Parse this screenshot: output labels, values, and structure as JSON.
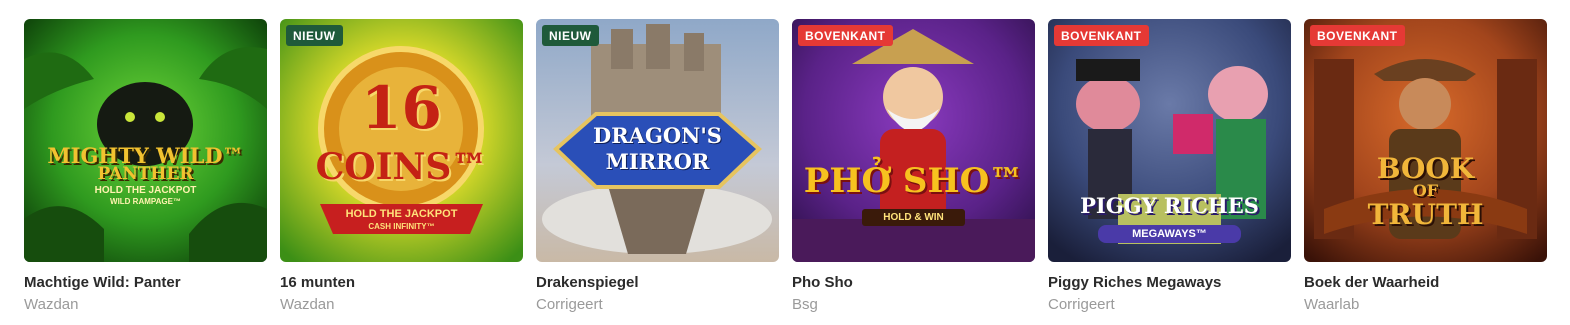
{
  "games": [
    {
      "title": "Machtige Wild: Panter",
      "provider": "Wazdan",
      "badge": "",
      "logo_line1": "MIGHTY WILD™",
      "logo_line2": "PANTHER",
      "logo_line3": "HOLD THE JACKPOT",
      "logo_line4": "WILD RAMPAGE™",
      "colors": {
        "bg1": "#2f9a1f",
        "bg2": "#0b3a08",
        "logo": "#f2c230"
      }
    },
    {
      "title": "16 munten",
      "provider": "Wazdan",
      "badge": "NIEUW",
      "logo_line1": "16",
      "logo_line2": "COINS™",
      "logo_line3": "HOLD THE JACKPOT",
      "logo_line4": "CASH INFINITY™",
      "colors": {
        "bg1": "#f5e23a",
        "bg2": "#3c8f16",
        "logo": "#e8a21a"
      }
    },
    {
      "title": "Drakenspiegel",
      "provider": "Corrigeert",
      "badge": "NIEUW",
      "logo_line1": "DRAGON'S",
      "logo_line2": "MIRROR",
      "colors": {
        "bg1": "#8fa8c8",
        "bg2": "#c9b9a6",
        "logo": "#2a4fb8"
      }
    },
    {
      "title": "Pho Sho",
      "provider": "Bsg",
      "badge": "BOVENKANT",
      "logo_line1": "PHỞ SHO™",
      "logo_line2": "HOLD & WIN",
      "colors": {
        "bg1": "#6a2a9a",
        "bg2": "#2a0f45",
        "logo": "#f7c21f"
      }
    },
    {
      "title": "Piggy Riches Megaways",
      "provider": "Corrigeert",
      "badge": "BOVENKANT",
      "logo_line1": "PIGGY RICHES",
      "logo_line2": "MEGAWAYS™",
      "colors": {
        "bg1": "#3a4a7a",
        "bg2": "#1a1f3a",
        "logo": "#4a3aa8"
      }
    },
    {
      "title": "Boek der Waarheid",
      "provider": "Waarlab",
      "badge": "BOVENKANT",
      "logo_line1": "BOOK",
      "logo_line2": "OF",
      "logo_line3": "TRUTH",
      "colors": {
        "bg1": "#a2451c",
        "bg2": "#3a1208",
        "logo": "#f1b63a"
      }
    }
  ]
}
